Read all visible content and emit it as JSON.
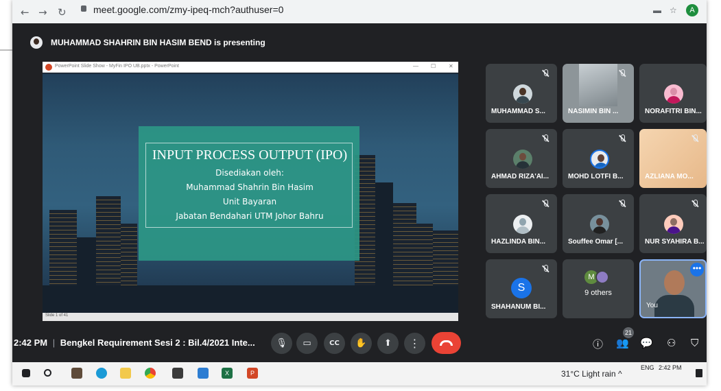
{
  "browser": {
    "url": "meet.google.com/zmy-ipeq-mch?authuser=0",
    "back": "←",
    "forward": "→",
    "reload": "↻",
    "profile": "A"
  },
  "meeting": {
    "presenter_text": "MUHAMMAD SHAHRIN BIN HASIM BEND is presenting",
    "time": "2:42 PM",
    "separator": "|",
    "title": "Bengkel Requirement Sesi 2 : Bil.4/2021 Inte...",
    "participant_count": "21"
  },
  "slide_window": {
    "title": "PowerPoint Slide Show - MyFin IPO UB.pptx - PowerPoint",
    "status": "Slide 1 of 41",
    "minimize": "—",
    "restore": "☐",
    "close": "✕"
  },
  "slide": {
    "title": "INPUT PROCESS OUTPUT (IPO)",
    "line1": "Disediakan oleh:",
    "line2": "Muhammad Shahrin Bin Hasim",
    "line3": "Unit Bayaran",
    "line4": "Jabatan Bendahari UTM Johor Bahru"
  },
  "participants": [
    {
      "name": "MUHAMMAD S..."
    },
    {
      "name": "NASIMIN BIN ..."
    },
    {
      "name": "NORAFITRI BIN..."
    },
    {
      "name": "AHMAD RIZA'AI..."
    },
    {
      "name": "MOHD LOTFI B..."
    },
    {
      "name": "AZLIANA MO..."
    },
    {
      "name": "HAZLINDA BIN..."
    },
    {
      "name": "Souffee Omar [..."
    },
    {
      "name": "NUR SYAHIRA B..."
    },
    {
      "name": "SHAHANUM BI...",
      "initial": "S"
    },
    {
      "others": "9 others",
      "initial": "M"
    },
    {
      "name": "You"
    }
  ],
  "controls": {
    "mic": "🎙",
    "camera": "▭",
    "captions": "CC",
    "hand": "✋",
    "present": "⬆",
    "more": "⋮",
    "info": "ⓘ",
    "people": "👥",
    "chat": "💬",
    "activities": "⚇",
    "safety": "⛉"
  },
  "taskbar": {
    "weather": "31°C  Light rain",
    "chevron": "^",
    "lang": "ENG",
    "time": "2:42 PM",
    "xl": "X",
    "pp": "P"
  },
  "colors": {
    "meet_bg": "#202124",
    "tile_bg": "#3c4043",
    "end_call": "#ea4335",
    "slide_teal": "#2c9785",
    "self_border": "#8ab4f8"
  }
}
